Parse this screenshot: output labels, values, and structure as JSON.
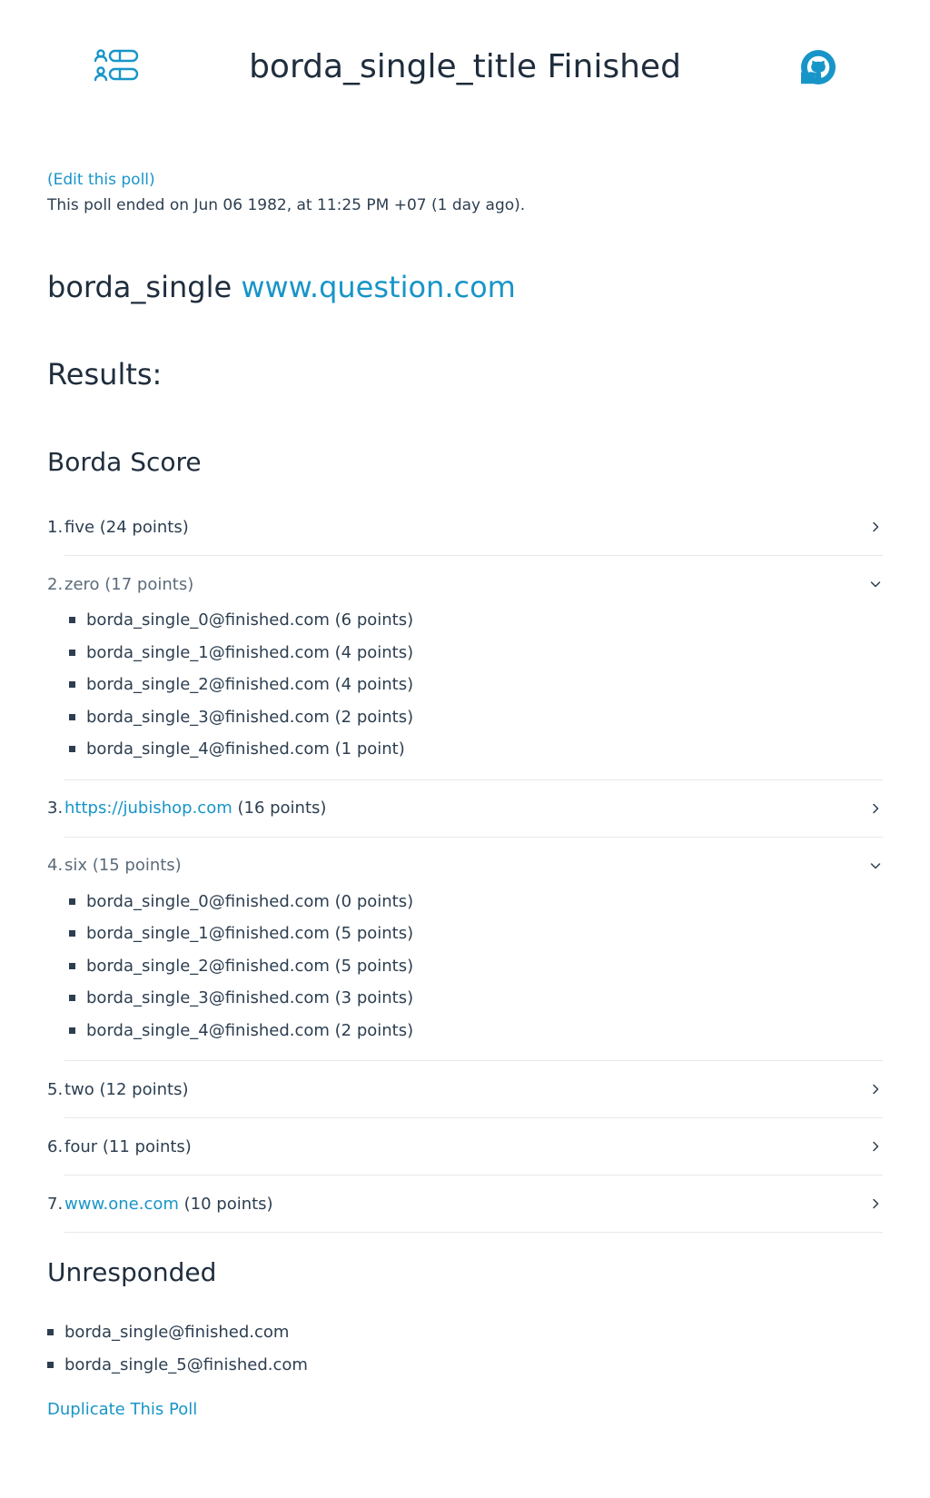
{
  "header": {
    "title": "borda_single_title Finished",
    "app_icon": "poll-list-icon",
    "github_icon": "github-icon"
  },
  "poll": {
    "edit_link": "(Edit this poll)",
    "ended_text": "This poll ended on Jun 06 1982, at 11:25 PM +07 (1 day ago).",
    "question_prefix": "borda_single",
    "question_link": "www.question.com"
  },
  "results": {
    "title": "Results:",
    "section_title": "Borda Score",
    "items": [
      {
        "num": "1.",
        "link": "",
        "text": "five (24 points)",
        "expanded": false,
        "voters": []
      },
      {
        "num": "2.",
        "link": "",
        "text": "zero (17 points)",
        "expanded": true,
        "voters": [
          "borda_single_0@finished.com (6 points)",
          "borda_single_1@finished.com (4 points)",
          "borda_single_2@finished.com (4 points)",
          "borda_single_3@finished.com (2 points)",
          "borda_single_4@finished.com (1 point)"
        ]
      },
      {
        "num": "3.",
        "link": "https://jubishop.com",
        "text": " (16 points)",
        "expanded": false,
        "voters": []
      },
      {
        "num": "4.",
        "link": "",
        "text": "six (15 points)",
        "expanded": true,
        "voters": [
          "borda_single_0@finished.com (0 points)",
          "borda_single_1@finished.com (5 points)",
          "borda_single_2@finished.com (5 points)",
          "borda_single_3@finished.com (3 points)",
          "borda_single_4@finished.com (2 points)"
        ]
      },
      {
        "num": "5.",
        "link": "",
        "text": "two (12 points)",
        "expanded": false,
        "voters": []
      },
      {
        "num": "6.",
        "link": "",
        "text": "four (11 points)",
        "expanded": false,
        "voters": []
      },
      {
        "num": "7.",
        "link": "www.one.com",
        "text": " (10 points)",
        "expanded": false,
        "voters": []
      }
    ]
  },
  "unresponded": {
    "title": "Unresponded",
    "users": [
      "borda_single@finished.com",
      "borda_single_5@finished.com"
    ]
  },
  "footer": {
    "duplicate_link": "Duplicate This Poll"
  },
  "colors": {
    "accent": "#1895c8",
    "text": "#1f2d3d",
    "divider": "#e5e8ec"
  }
}
